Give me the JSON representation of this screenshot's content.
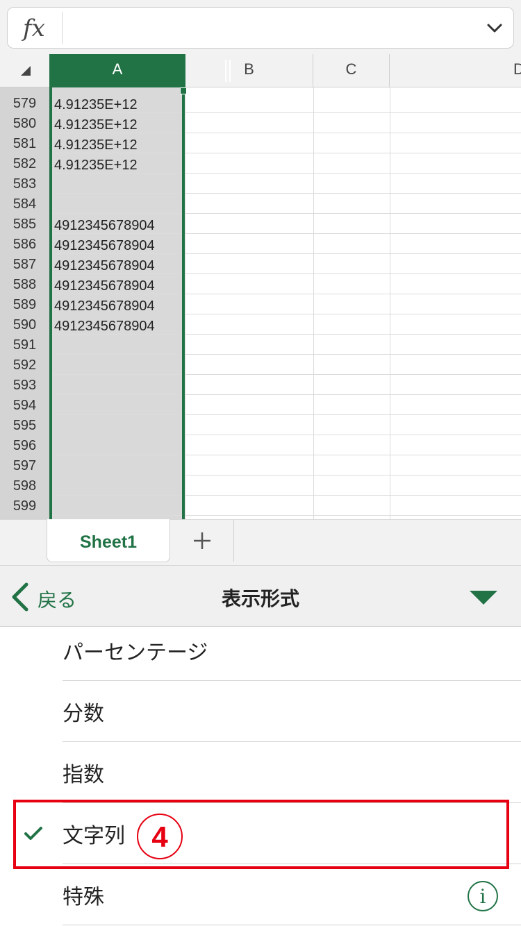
{
  "formula_bar": {
    "fx_label": "fx",
    "value": ""
  },
  "columns": [
    "A",
    "B",
    "C",
    "D"
  ],
  "rows": [
    {
      "num": "579",
      "a": "4.91235E+12"
    },
    {
      "num": "580",
      "a": "4.91235E+12"
    },
    {
      "num": "581",
      "a": "4.91235E+12"
    },
    {
      "num": "582",
      "a": "4.91235E+12"
    },
    {
      "num": "583",
      "a": ""
    },
    {
      "num": "584",
      "a": ""
    },
    {
      "num": "585",
      "a": "4912345678904"
    },
    {
      "num": "586",
      "a": "4912345678904"
    },
    {
      "num": "587",
      "a": "4912345678904"
    },
    {
      "num": "588",
      "a": "4912345678904"
    },
    {
      "num": "589",
      "a": "4912345678904"
    },
    {
      "num": "590",
      "a": "4912345678904"
    },
    {
      "num": "591",
      "a": ""
    },
    {
      "num": "592",
      "a": ""
    },
    {
      "num": "593",
      "a": ""
    },
    {
      "num": "594",
      "a": ""
    },
    {
      "num": "595",
      "a": ""
    },
    {
      "num": "596",
      "a": ""
    },
    {
      "num": "597",
      "a": ""
    },
    {
      "num": "598",
      "a": ""
    },
    {
      "num": "599",
      "a": ""
    }
  ],
  "sheet_tab": {
    "label": "Sheet1",
    "add_symbol": "+"
  },
  "panel": {
    "back_label": "戻る",
    "title": "表示形式",
    "items": [
      {
        "label": "パーセンテージ",
        "checked": false
      },
      {
        "label": "分数",
        "checked": false
      },
      {
        "label": "指数",
        "checked": false
      },
      {
        "label": "文字列",
        "checked": true
      },
      {
        "label": "特殊",
        "checked": false
      }
    ],
    "annotation_badge": "4",
    "info_symbol": "i"
  },
  "colors": {
    "accent": "#217346",
    "highlight": "#e60012"
  }
}
